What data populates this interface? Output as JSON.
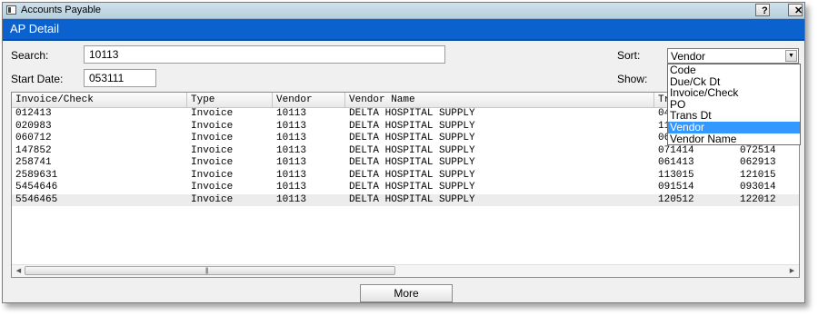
{
  "window": {
    "title": "Accounts Payable",
    "help_label": "?",
    "close_label": "✕"
  },
  "header": {
    "title": "AP Detail"
  },
  "filters": {
    "search_label": "Search:",
    "search_value": "10113",
    "start_date_label": "Start Date:",
    "start_date_value": "053111",
    "sort_label": "Sort:",
    "sort_value": "Vendor",
    "show_label": "Show:",
    "sort_options": [
      "Code",
      "Due/Ck Dt",
      "Invoice/Check",
      "PO",
      "Trans Dt",
      "Vendor",
      "Vendor Name"
    ],
    "sort_selected_index": 5
  },
  "table": {
    "columns": [
      "Invoice/Check",
      "Type",
      "Vendor",
      "Vendor Name",
      "Tr",
      ""
    ],
    "rows": [
      [
        "012413",
        "Invoice",
        "10113",
        "DELTA HOSPITAL SUPPLY",
        "04",
        ""
      ],
      [
        "020983",
        "Invoice",
        "10113",
        "DELTA HOSPITAL SUPPLY",
        "11",
        ""
      ],
      [
        "060712",
        "Invoice",
        "10113",
        "DELTA HOSPITAL SUPPLY",
        "06",
        ""
      ],
      [
        "147852",
        "Invoice",
        "10113",
        "DELTA HOSPITAL SUPPLY",
        "071414",
        "072514"
      ],
      [
        "258741",
        "Invoice",
        "10113",
        "DELTA HOSPITAL SUPPLY",
        "061413",
        "062913"
      ],
      [
        "2589631",
        "Invoice",
        "10113",
        "DELTA HOSPITAL SUPPLY",
        "113015",
        "121015"
      ],
      [
        "5454646",
        "Invoice",
        "10113",
        "DELTA HOSPITAL SUPPLY",
        "091514",
        "093014"
      ],
      [
        "5546465",
        "Invoice",
        "10113",
        "DELTA HOSPITAL SUPPLY",
        "120512",
        "122012"
      ]
    ]
  },
  "footer": {
    "more_label": "More"
  },
  "colors": {
    "header_band": "#0b62cf",
    "selection": "#3399ff"
  }
}
